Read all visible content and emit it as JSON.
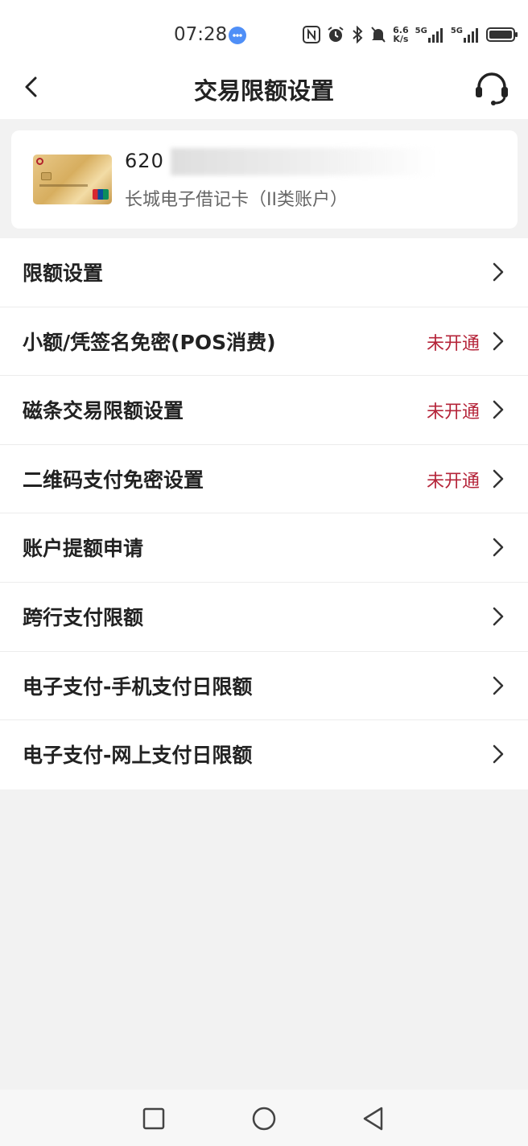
{
  "status_bar": {
    "time": "07:28",
    "net_speed_value": "6.6",
    "net_speed_unit": "K/s",
    "signal1": "5G",
    "signal2": "5G",
    "icons": [
      "chat-bubble-icon",
      "nfc-icon",
      "alarm-icon",
      "bluetooth-icon",
      "mute-bell-icon",
      "signal-icon",
      "battery-icon"
    ]
  },
  "header": {
    "title": "交易限额设置",
    "back_icon": "chevron-left-icon",
    "support_icon": "headset-icon"
  },
  "card": {
    "number_prefix": "6",
    "number_suffix": "2",
    "number_tail": "0",
    "type_label": "长城电子借记卡（II类账户）"
  },
  "menu": {
    "items": [
      {
        "label": "限额设置",
        "status": ""
      },
      {
        "label": "小额/凭签名免密(POS消费)",
        "status": "未开通"
      },
      {
        "label": "磁条交易限额设置",
        "status": "未开通"
      },
      {
        "label": "二维码支付免密设置",
        "status": "未开通"
      },
      {
        "label": "账户提额申请",
        "status": ""
      },
      {
        "label": "跨行支付限额",
        "status": ""
      },
      {
        "label": "电子支付-手机支付日限额",
        "status": ""
      },
      {
        "label": "电子支付-网上支付日限额",
        "status": ""
      }
    ]
  },
  "colors": {
    "accent_red": "#b5253a",
    "background": "#f2f2f2",
    "text": "#222222"
  }
}
